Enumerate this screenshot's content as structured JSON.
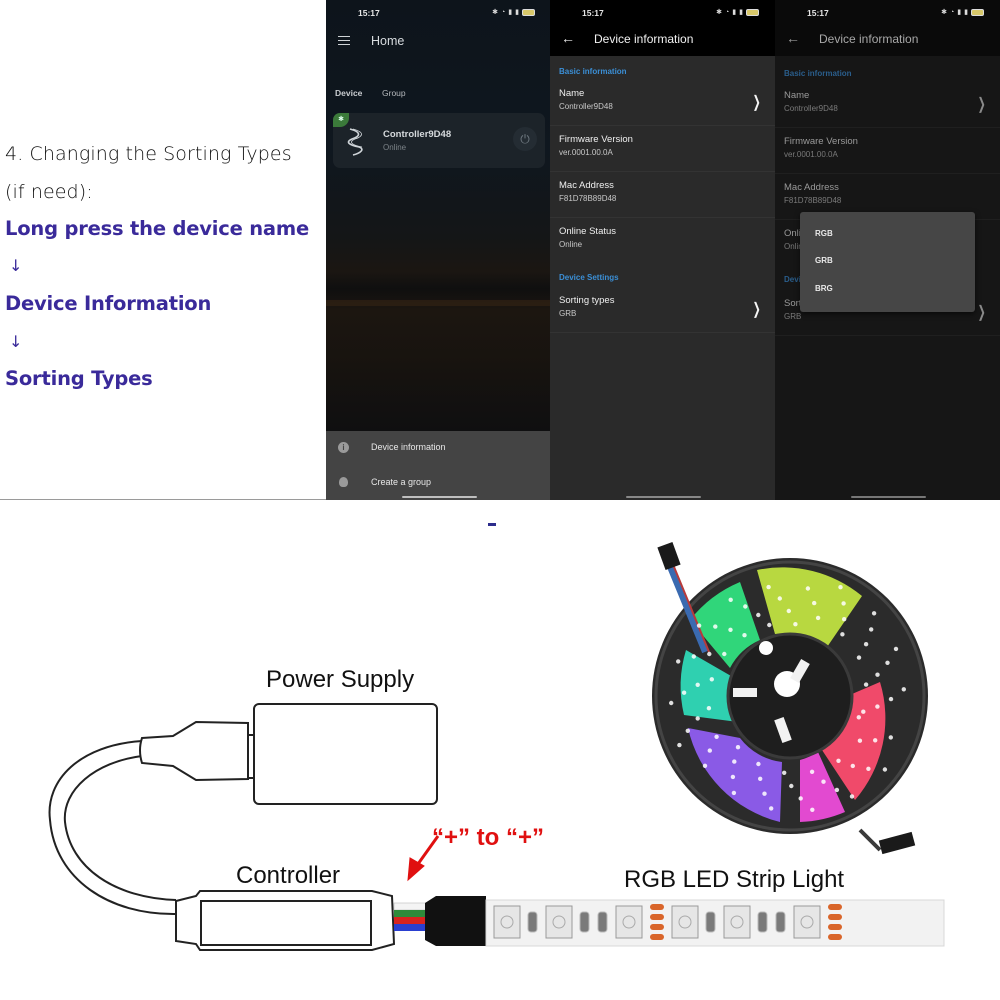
{
  "instructions": {
    "step_title": "4. Changing the Sorting Types",
    "step_subtitle": "(if need):",
    "steps": [
      "Long press the device name",
      "Device Information",
      "Sorting Types"
    ],
    "arrow": "↓"
  },
  "phones": {
    "status_time": "15:17",
    "home": {
      "title": "Home",
      "tabs": [
        "Device",
        "Group"
      ],
      "device": {
        "name": "Controller9D48",
        "status": "Online",
        "bluetooth_badge": "✱",
        "power_icon": "⏻"
      },
      "context_menu": [
        {
          "icon": "info-icon",
          "glyph": "i",
          "label": "Device information"
        },
        {
          "icon": "bulb-icon",
          "glyph": "",
          "label": "Create a group"
        }
      ]
    },
    "device_info": {
      "title": "Device information",
      "back_glyph": "←",
      "sections": {
        "basic": "Basic information",
        "settings": "Device Settings"
      },
      "rows": [
        {
          "label": "Name",
          "value": "Controller9D48",
          "has_chevron": true
        },
        {
          "label": "Firmware Version",
          "value": "ver.0001.00.0A",
          "has_chevron": false
        },
        {
          "label": "Mac Address",
          "value": "F81D78B89D48",
          "has_chevron": false
        },
        {
          "label": "Online Status",
          "value": "Online",
          "has_chevron": false
        }
      ],
      "sorting": {
        "label": "Sorting types",
        "value": "GRB"
      },
      "chevron_glyph": "❯"
    },
    "sorting_dropdown": {
      "options": [
        "RGB",
        "GRB",
        "BRG"
      ]
    }
  },
  "diagram": {
    "power_supply_label": "Power Supply",
    "controller_label": "Controller",
    "strip_label": "RGB LED Strip Light",
    "polarity_note": "“+” to “+”",
    "wire_colors": {
      "white": "#f4f4f4",
      "green": "#2e8b3a",
      "red": "#d8231e",
      "blue": "#2a3fd0"
    },
    "accent_red": "#e01010"
  }
}
